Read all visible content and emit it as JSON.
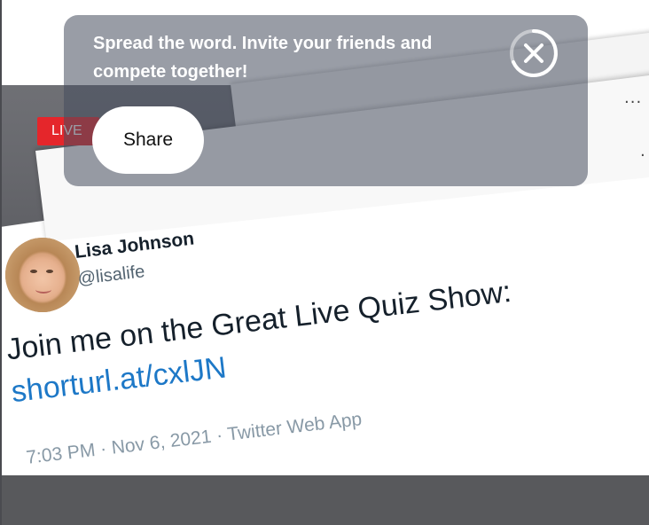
{
  "overlay": {
    "message": "Spread the word. Invite your friends and compete together!",
    "share_label": "Share",
    "close_icon": "close-icon"
  },
  "stream": {
    "live_label": "LIVE",
    "more_options_glyph": "...",
    "more_options_glyph_2": "."
  },
  "tweet": {
    "author_name": "Lisa Johnson",
    "author_handle": "@lisalife",
    "text": "Join me on the Great Live Quiz Show:",
    "link": "shorturl.at/cxlJN",
    "meta": "7:03 PM · Nov 6, 2021 · Twitter Web App",
    "avatar_icon": "profile-photo"
  },
  "colors": {
    "live_red": "#e5262b",
    "link_blue": "#1d78c7",
    "overlay": "#464c5c",
    "bottom_bar": "#58595c"
  }
}
